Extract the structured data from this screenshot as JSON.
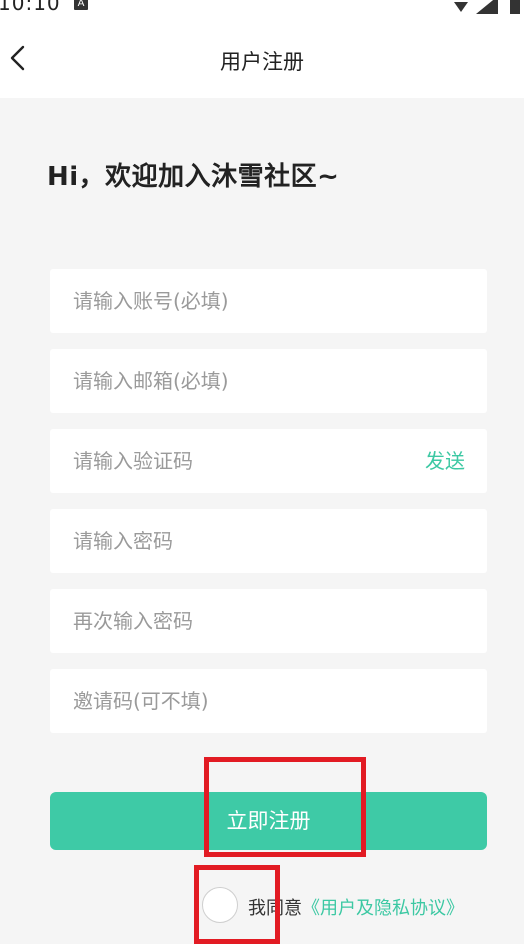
{
  "status": {
    "time": "10:10",
    "notif_letter": "A"
  },
  "header": {
    "title": "用户注册",
    "back_icon": "chevron-left-icon"
  },
  "welcome": "Hi，欢迎加入沐雪社区~",
  "form": {
    "account_placeholder": "请输入账号(必填)",
    "email_placeholder": "请输入邮箱(必填)",
    "code_placeholder": "请输入验证码",
    "send_label": "发送",
    "password_placeholder": "请输入密码",
    "password_confirm_placeholder": "再次输入密码",
    "invite_placeholder": "邀请码(可不填)"
  },
  "register_label": "立即注册",
  "agreement": {
    "prefix": "我同意",
    "link": "《用户及隐私协议》"
  },
  "colors": {
    "accent": "#3ecaa6",
    "highlight": "#e21b23"
  }
}
